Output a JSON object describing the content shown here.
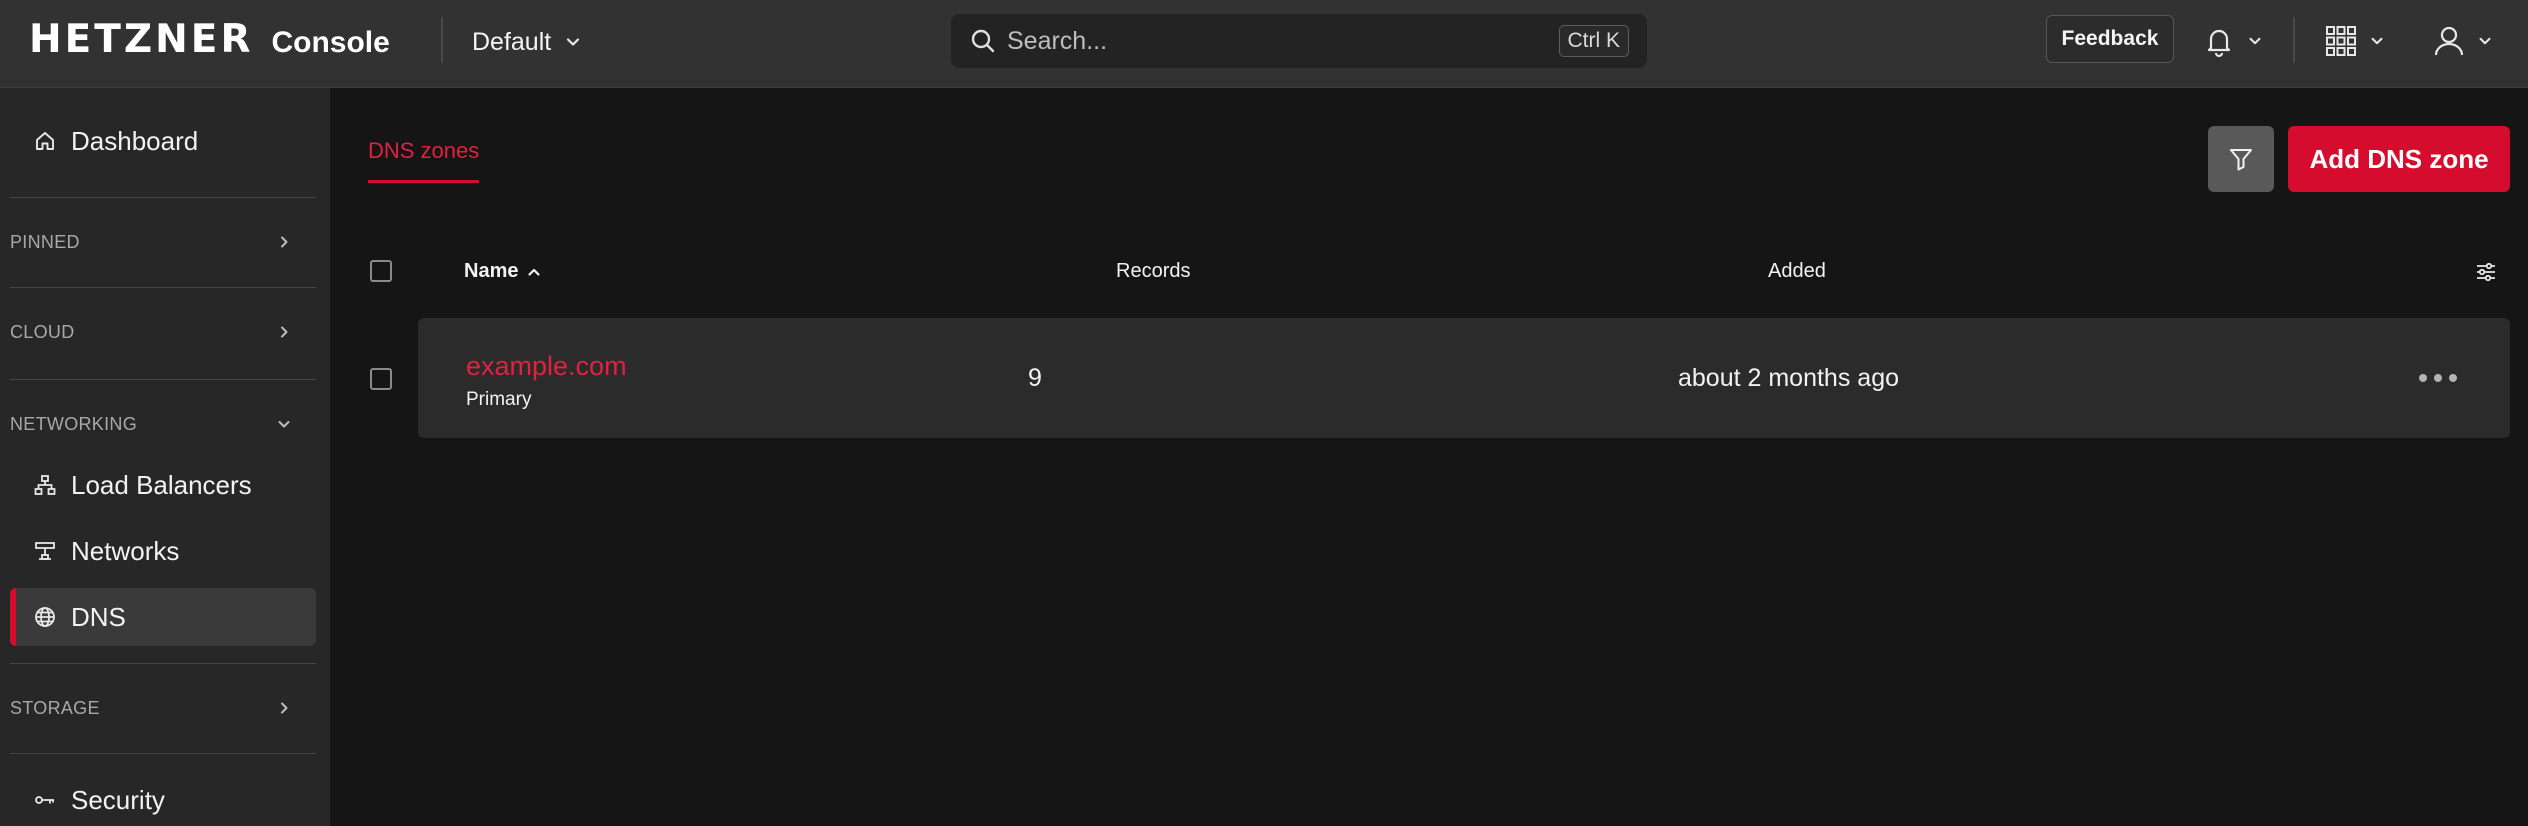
{
  "header": {
    "logo": "HETZNER",
    "product": "Console",
    "project": "Default",
    "search": {
      "placeholder": "Search...",
      "shortcut": "Ctrl K"
    },
    "feedback_label": "Feedback"
  },
  "sidebar": {
    "dashboard": "Dashboard",
    "sections": {
      "pinned": "PINNED",
      "cloud": "CLOUD",
      "networking": "NETWORKING",
      "storage": "STORAGE"
    },
    "networking_items": [
      "Load Balancers",
      "Networks",
      "DNS"
    ],
    "security": "Security"
  },
  "main": {
    "tab": "DNS zones",
    "add_button": "Add DNS zone",
    "table": {
      "columns": [
        "Name",
        "Records",
        "Added"
      ],
      "rows": [
        {
          "name": "example.com",
          "type": "Primary",
          "records": "9",
          "added": "about 2 months ago"
        }
      ]
    }
  },
  "colors": {
    "accent": "#d50c2d",
    "topbar": "#323232",
    "sidebar": "#272727",
    "background": "#151515"
  },
  "icons": [
    "search-icon",
    "chevron-down-icon",
    "bell-icon",
    "grid-icon",
    "user-icon",
    "home-icon",
    "chevron-right-icon",
    "load-balancer-icon",
    "network-icon",
    "globe-icon",
    "key-icon",
    "filter-icon",
    "sort-up-icon",
    "column-settings-icon",
    "more-icon"
  ]
}
